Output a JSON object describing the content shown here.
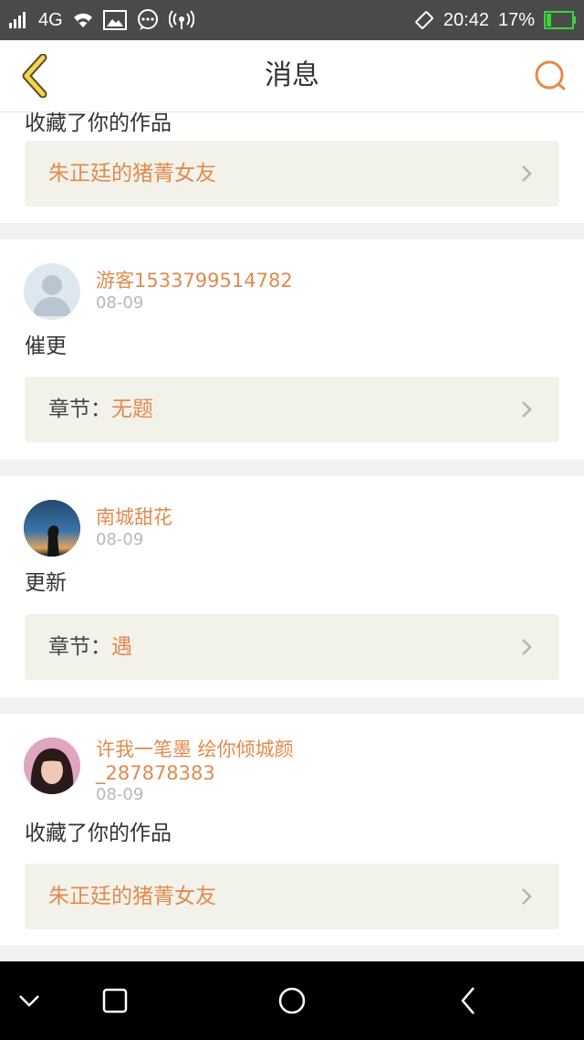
{
  "status_bar": {
    "network": "4G",
    "time": "20:42",
    "battery": "17%",
    "battery_level": 0.17,
    "icons": [
      "signal-icon",
      "wifi-icon",
      "image-icon",
      "chat-icon",
      "hotspot-icon",
      "rotate-icon",
      "battery-icon"
    ]
  },
  "header": {
    "title": "消息",
    "back_icon": "chevron-left-icon",
    "search_icon": "search-icon",
    "accent_color": "#e38a4e"
  },
  "messages": [
    {
      "partial_text": "收藏了你的作品",
      "ref_prefix": "",
      "ref_title": "朱正廷的猪菁女友"
    },
    {
      "user": "游客1533799514782",
      "date": "08-09",
      "avatar": "default-avatar",
      "text": "催更",
      "ref_prefix": "章节：",
      "ref_title": "无题"
    },
    {
      "user": "南城甜花",
      "date": "08-09",
      "avatar": "photo-avatar",
      "text": "更新",
      "ref_prefix": "章节：",
      "ref_title": "遇"
    },
    {
      "user_line1": "许我一笔墨 绘你倾城颜",
      "user_line2": "_287878383",
      "date": "08-09",
      "avatar": "photo-avatar",
      "text": "收藏了你的作品",
      "ref_prefix": "",
      "ref_title": "朱正廷的猪菁女友"
    }
  ],
  "nav_bar": {
    "buttons": [
      "chevron-down-icon",
      "square-icon",
      "circle-icon",
      "back-triangle-icon"
    ]
  }
}
